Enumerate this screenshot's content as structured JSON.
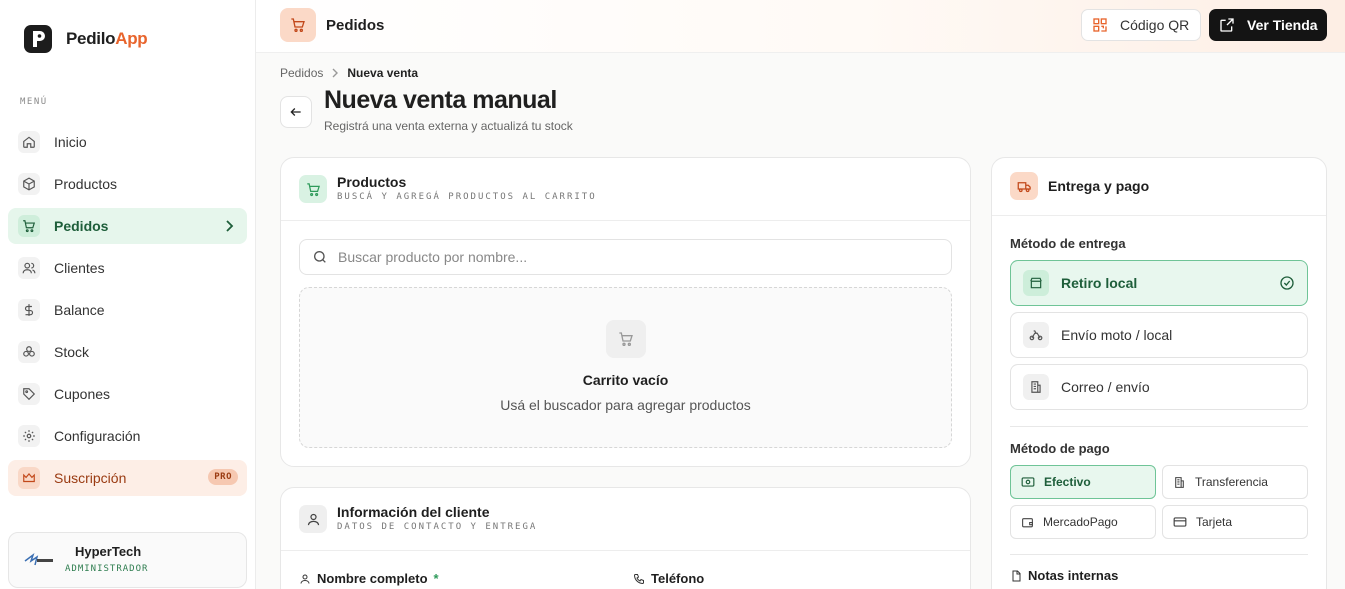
{
  "brand": {
    "name_main": "Pedilo",
    "name_accent": "App"
  },
  "colors": {
    "accent": "#e8642c",
    "success": "#2e9a5a",
    "dark": "#141414"
  },
  "sidebar": {
    "menu_label": "MENÚ",
    "items": [
      {
        "label": "Inicio",
        "icon": "home-icon"
      },
      {
        "label": "Productos",
        "icon": "box-icon"
      },
      {
        "label": "Pedidos",
        "icon": "cart-icon",
        "active": true
      },
      {
        "label": "Clientes",
        "icon": "users-icon"
      },
      {
        "label": "Balance",
        "icon": "dollar-icon"
      },
      {
        "label": "Stock",
        "icon": "stock-icon"
      },
      {
        "label": "Cupones",
        "icon": "tag-icon"
      },
      {
        "label": "Configuración",
        "icon": "gear-icon"
      }
    ],
    "subscription": {
      "label": "Suscripción",
      "badge": "PRO"
    },
    "user": {
      "name": "HyperTech",
      "role": "ADMINISTRADOR"
    }
  },
  "topbar": {
    "title": "Pedidos",
    "qr_label": "Código QR",
    "store_label": "Ver Tienda"
  },
  "page": {
    "breadcrumb": [
      "Pedidos",
      "Nueva venta"
    ],
    "title": "Nueva venta manual",
    "subtitle": "Registrá una venta externa y actualizá tu stock"
  },
  "products": {
    "title": "Productos",
    "subtitle": "BUSCÁ Y AGREGÁ PRODUCTOS AL CARRITO",
    "search_placeholder": "Buscar producto por nombre...",
    "empty_title": "Carrito vacío",
    "empty_subtitle": "Usá el buscador para agregar productos"
  },
  "client": {
    "title": "Información del cliente",
    "subtitle": "DATOS DE CONTACTO Y ENTREGA",
    "name_label": "Nombre completo",
    "required_mark": "*",
    "phone_label": "Teléfono"
  },
  "delivery": {
    "title": "Entrega y pago",
    "method_label": "Método de entrega",
    "methods": [
      {
        "label": "Retiro local",
        "selected": true
      },
      {
        "label": "Envío moto / local"
      },
      {
        "label": "Correo / envío"
      }
    ],
    "payment_label": "Método de pago",
    "payments": [
      {
        "label": "Efectivo",
        "selected": true
      },
      {
        "label": "Transferencia"
      },
      {
        "label": "MercadoPago"
      },
      {
        "label": "Tarjeta"
      }
    ],
    "notes_label": "Notas internas"
  }
}
